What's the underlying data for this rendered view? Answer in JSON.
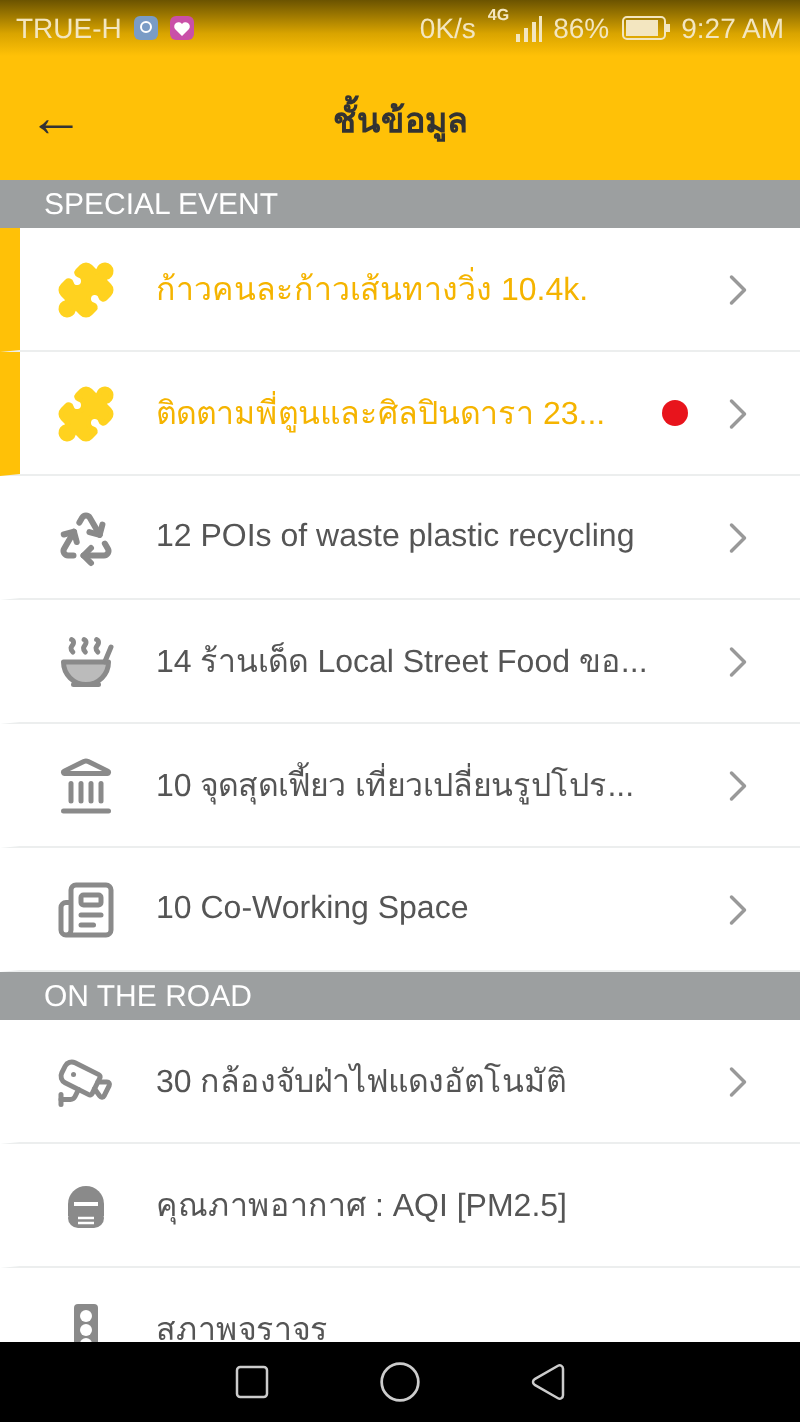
{
  "status_bar": {
    "carrier": "TRUE-H",
    "speed": "0K/s",
    "network": "4G",
    "battery": "86%",
    "time": "9:27 AM"
  },
  "header": {
    "back_icon": "←",
    "title": "ชั้นข้อมูล"
  },
  "sections": [
    {
      "title": "SPECIAL EVENT",
      "items": [
        {
          "label": "ก้าวคนละก้าวเส้นทางวิ่ง 10.4k.",
          "kind": "puzzle",
          "highlighted": true,
          "dot": false,
          "chevron": true
        },
        {
          "label": "ติดตามพี่ตูนและศิลปินดารา 23...",
          "kind": "puzzle",
          "highlighted": true,
          "dot": true,
          "chevron": true
        },
        {
          "label": "12 POIs of waste plastic recycling",
          "kind": "recycle",
          "highlighted": false,
          "dot": false,
          "chevron": true
        },
        {
          "label": "14 ร้านเด็ด Local Street Food ขอ...",
          "kind": "bowl",
          "highlighted": false,
          "dot": false,
          "chevron": true
        },
        {
          "label": "10 จุดสุดเฟี้ยว เที่ยวเปลี่ยนรูปโปร...",
          "kind": "landmark",
          "highlighted": false,
          "dot": false,
          "chevron": true
        },
        {
          "label": "10 Co-Working Space",
          "kind": "document",
          "highlighted": false,
          "dot": false,
          "chevron": true
        }
      ]
    },
    {
      "title": "ON THE ROAD",
      "items": [
        {
          "label": "30 กล้องจับฝ่าไฟแดงอัตโนมัติ",
          "kind": "cctv",
          "highlighted": false,
          "dot": false,
          "chevron": true
        },
        {
          "label": "คุณภาพอากาศ : AQI [PM2.5]",
          "kind": "mask",
          "highlighted": false,
          "dot": false,
          "chevron": false
        },
        {
          "label": "สภาพจราจร",
          "kind": "traffic",
          "highlighted": false,
          "dot": false,
          "chevron": false
        }
      ]
    }
  ]
}
